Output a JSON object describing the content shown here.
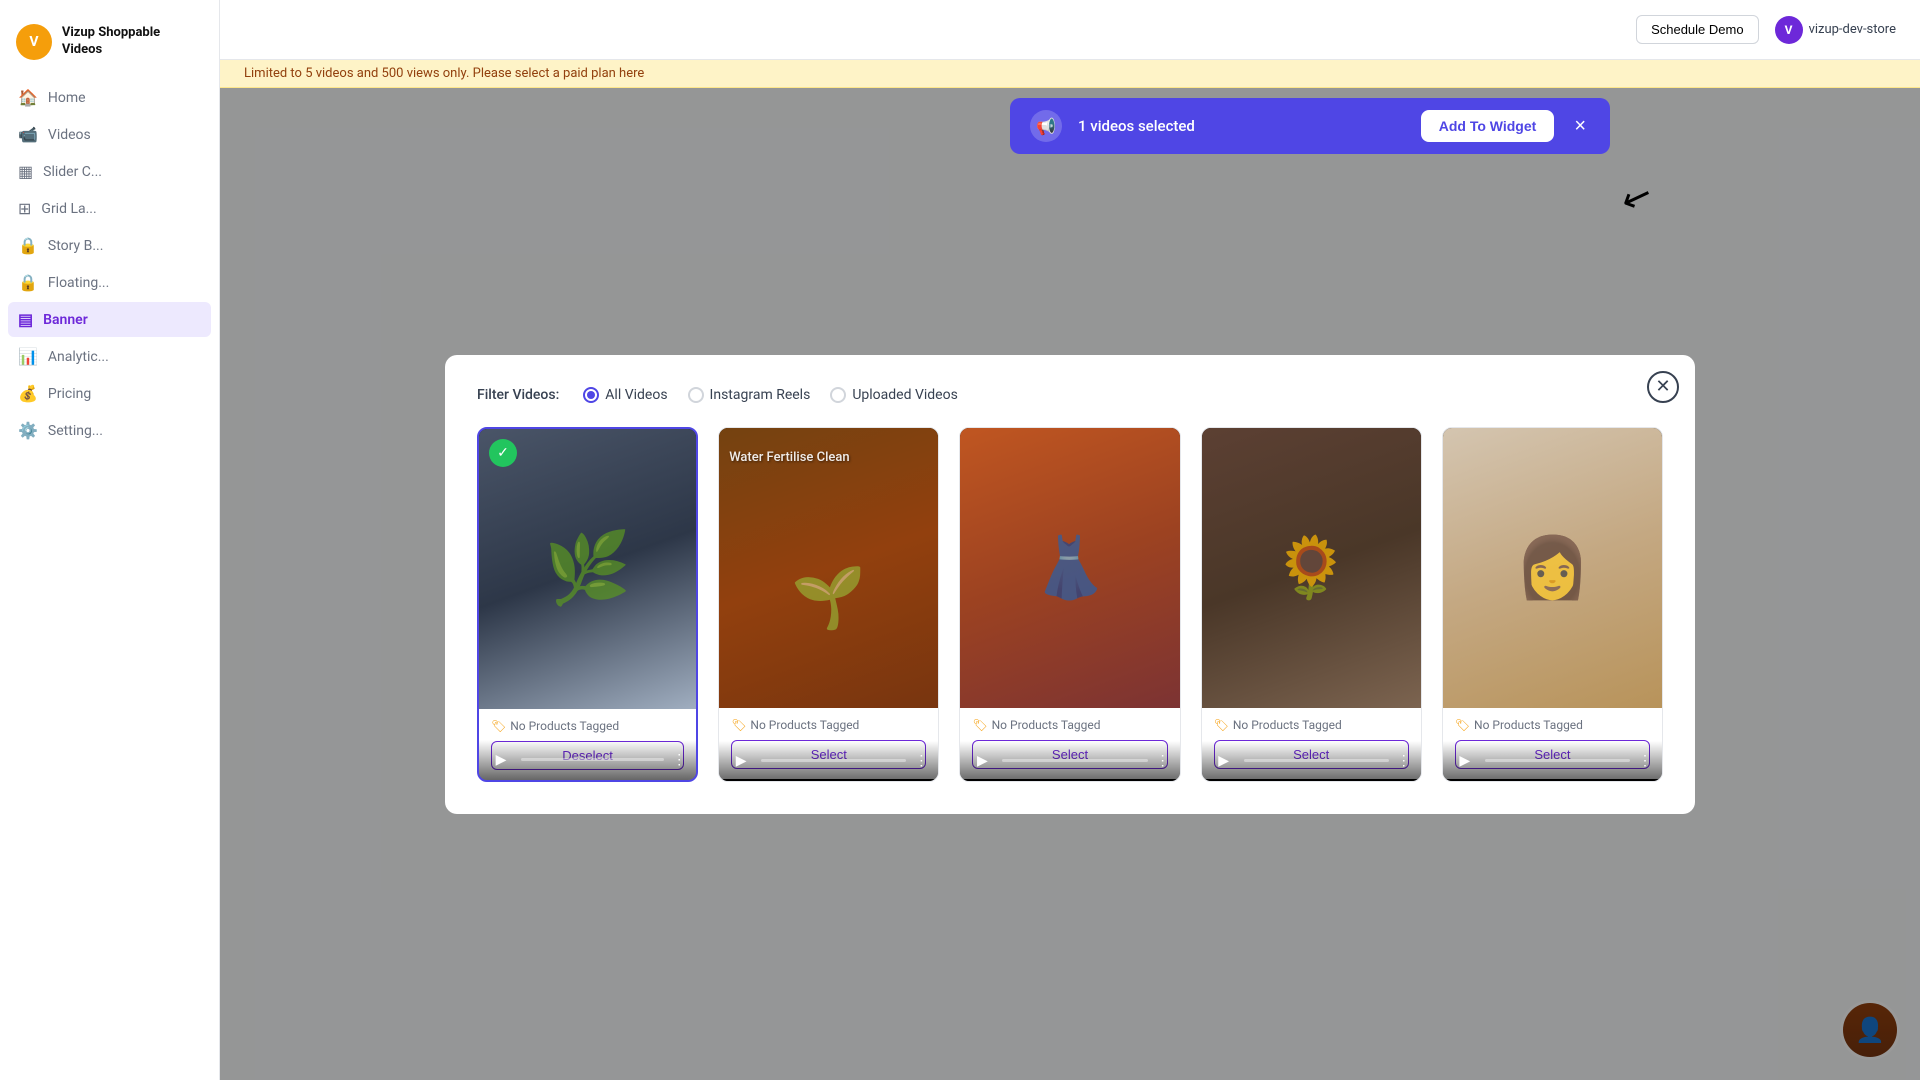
{
  "app": {
    "logo_initials": "V",
    "logo_title": "Vizup Shoppable Videos"
  },
  "sidebar": {
    "items": [
      {
        "id": "home",
        "label": "Home",
        "icon": "🏠"
      },
      {
        "id": "videos",
        "label": "Videos",
        "icon": "⬜"
      },
      {
        "id": "slider",
        "label": "Slider C...",
        "icon": "⬜"
      },
      {
        "id": "grid",
        "label": "Grid La...",
        "icon": "⬜"
      },
      {
        "id": "story",
        "label": "Story B...",
        "icon": "🔒"
      },
      {
        "id": "floating",
        "label": "Floating...",
        "icon": "🔒"
      },
      {
        "id": "banner",
        "label": "Banner",
        "icon": "⬜",
        "active": true
      },
      {
        "id": "analytics",
        "label": "Analytic...",
        "icon": "⬜"
      },
      {
        "id": "pricing",
        "label": "Pricing",
        "icon": "⬜"
      },
      {
        "id": "settings",
        "label": "Setting...",
        "icon": "⬜"
      }
    ]
  },
  "header": {
    "schedule_demo": "Schedule Demo",
    "store_initial": "V",
    "store_name": "vizup-dev-store"
  },
  "limit_banner": {
    "text": "Limited to 5 videos and 500 views only. Please select a paid plan here"
  },
  "notification": {
    "icon": "📢",
    "text": "1 videos selected",
    "add_button": "Add To Widget",
    "close": "×"
  },
  "modal": {
    "filter": {
      "label": "Filter Videos:",
      "options": [
        {
          "id": "all",
          "label": "All Videos",
          "checked": true
        },
        {
          "id": "reels",
          "label": "Instagram Reels",
          "checked": false
        },
        {
          "id": "uploaded",
          "label": "Uploaded Videos",
          "checked": false
        }
      ]
    },
    "videos": [
      {
        "id": 1,
        "thumb_class": "thumb-1",
        "selected": true,
        "overlay_text": "",
        "no_products": "No Products Tagged",
        "button": "Deselect",
        "button_type": "deselect"
      },
      {
        "id": 2,
        "thumb_class": "thumb-2",
        "selected": false,
        "overlay_text": "Water Fertilise Clean",
        "no_products": "No Products Tagged",
        "button": "Select",
        "button_type": "select"
      },
      {
        "id": 3,
        "thumb_class": "thumb-3",
        "selected": false,
        "overlay_text": "",
        "no_products": "No Products Tagged",
        "button": "Select",
        "button_type": "select"
      },
      {
        "id": 4,
        "thumb_class": "thumb-4",
        "selected": false,
        "overlay_text": "",
        "no_products": "No Products Tagged",
        "button": "Select",
        "button_type": "select"
      },
      {
        "id": 5,
        "thumb_class": "thumb-5",
        "selected": false,
        "overlay_text": "",
        "no_products": "No Products Tagged",
        "button": "Select",
        "button_type": "select"
      }
    ],
    "close_label": "×"
  }
}
